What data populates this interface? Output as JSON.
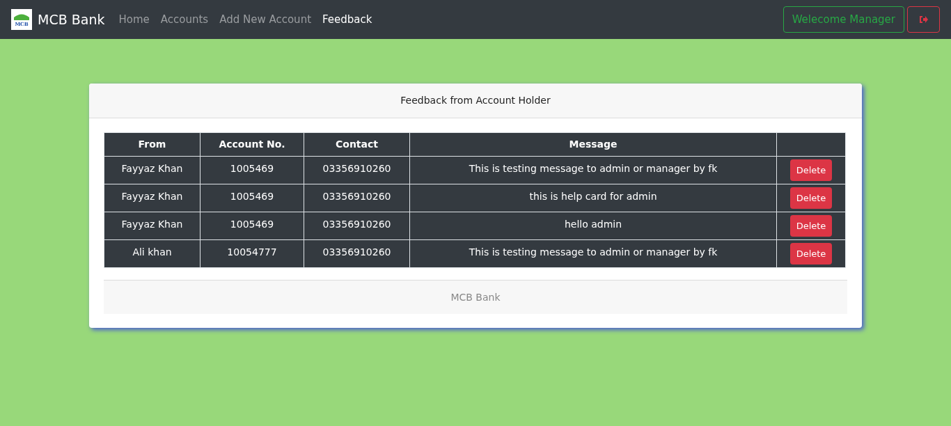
{
  "navbar": {
    "logo_text": "MCB",
    "brand": "MCB Bank",
    "links": [
      {
        "label": "Home",
        "selected": false
      },
      {
        "label": "Accounts",
        "selected": false
      },
      {
        "label": "Add New Account",
        "selected": false
      },
      {
        "label": "Feedback",
        "selected": true
      }
    ],
    "welcome": "Welecome Manager"
  },
  "card": {
    "title": "Feedback from Account Holder",
    "table": {
      "columns": [
        "From",
        "Account No.",
        "Contact",
        "Message"
      ],
      "rows": [
        {
          "from": "Fayyaz Khan",
          "account": "1005469",
          "contact": "03356910260",
          "message": "This is testing message to admin or manager by fk",
          "action": "Delete"
        },
        {
          "from": "Fayyaz Khan",
          "account": "1005469",
          "contact": "03356910260",
          "message": "this is help card for admin",
          "action": "Delete"
        },
        {
          "from": "Fayyaz Khan",
          "account": "1005469",
          "contact": "03356910260",
          "message": "hello admin",
          "action": "Delete"
        },
        {
          "from": "Ali khan",
          "account": "10054777",
          "contact": "03356910260",
          "message": "This is testing message to admin or manager by fk",
          "action": "Delete"
        }
      ]
    },
    "footer": "MCB Bank"
  }
}
